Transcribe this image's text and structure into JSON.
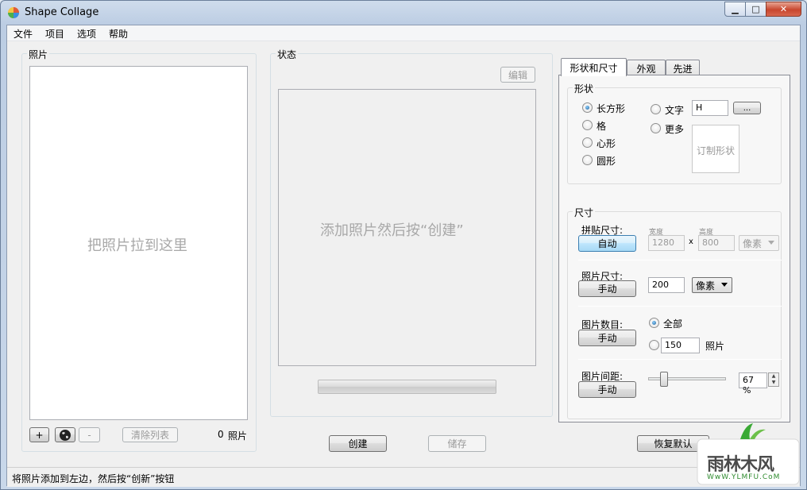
{
  "window": {
    "title": "Shape Collage",
    "minimize": "▁",
    "maximize": "□",
    "close": "✕"
  },
  "menu": [
    "文件",
    "项目",
    "选项",
    "帮助"
  ],
  "photos": {
    "group_label": "照片",
    "drop_hint": "把照片拉到这里",
    "add_button": "+",
    "remove_button": "-",
    "clear_button": "清除列表",
    "count": "0",
    "count_unit": "照片"
  },
  "status": {
    "group_label": "状态",
    "edit_button": "编辑",
    "hint": "添加照片然后按“创建”",
    "progress": 0
  },
  "actions": {
    "create": "创建",
    "save": "储存",
    "restore_defaults": "恢复默认"
  },
  "tabs": [
    "形状和尺寸",
    "外观",
    "先进"
  ],
  "shape": {
    "group_label": "形状",
    "options": [
      "长方形",
      "格",
      "心形",
      "圆形"
    ],
    "text_option": "文字",
    "text_value": "H",
    "more_option": "更多",
    "browse_button": "...",
    "custom_shape": "订制形状",
    "selected": "长方形"
  },
  "size": {
    "group_label": "尺寸",
    "collage_size_label": "拼贴尺寸:",
    "collage_size_mode": "自动",
    "width_label": "宽度",
    "height_label": "高度",
    "width_value": "1280",
    "height_value": "800",
    "times": "x",
    "collage_unit": "像素",
    "photo_size_label": "照片尺寸:",
    "photo_size_mode": "手动",
    "photo_size_value": "200",
    "photo_unit": "像素",
    "photo_count_label": "图片数目:",
    "photo_count_mode": "手动",
    "all_option": "全部",
    "count_value": "150",
    "count_unit": "照片",
    "spacing_label": "图片间距:",
    "spacing_mode": "手动",
    "spacing_value": "67 %",
    "spacing_level": 0.2
  },
  "statusbar": {
    "text": "将照片添加到左边，然后按“创新”按钮"
  },
  "watermark": {
    "brand": "雨林木风",
    "url": "WwW.YLMFU.CoM"
  },
  "colors": {
    "accent_blue": "#3c7fb1",
    "hint_gray": "#a8a8a8",
    "close_red": "#c8462e"
  }
}
